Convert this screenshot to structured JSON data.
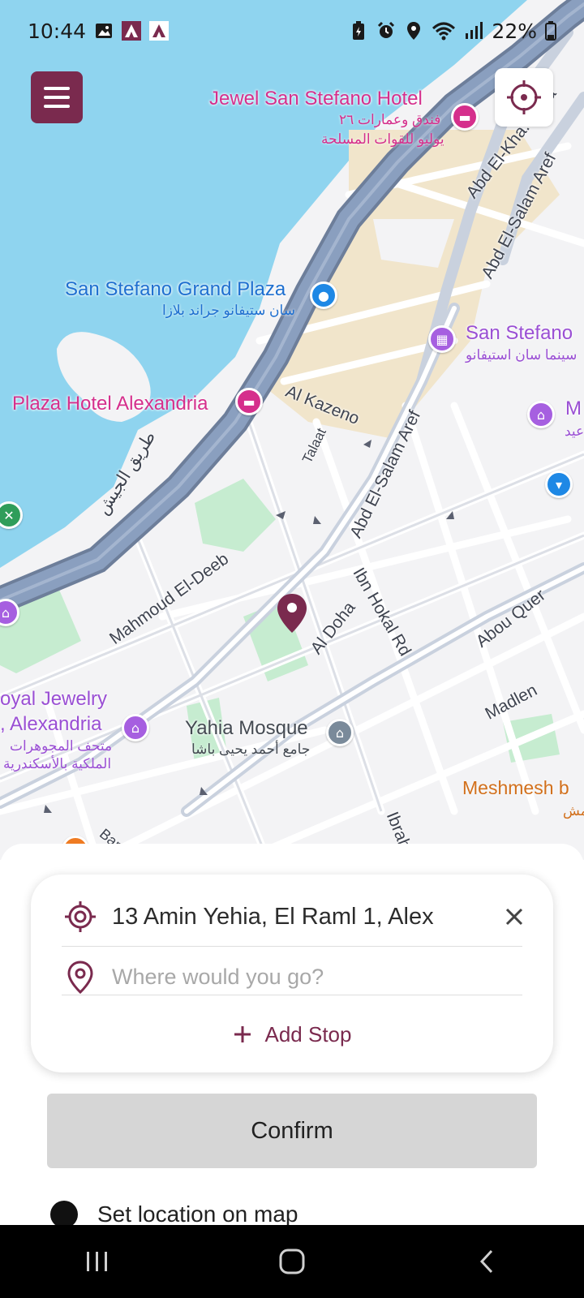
{
  "status_bar": {
    "time": "10:44",
    "battery": "22%"
  },
  "map": {
    "poi": {
      "jewel_hotel": "Jewel San Stefano Hotel",
      "jewel_hotel_ar1": "فندق وعمارات ٢٦",
      "jewel_hotel_ar2": "يوليو للقوات المسلحة",
      "grand_plaza": "San Stefano Grand Plaza",
      "grand_plaza_ar": "سان ستيفانو جراند بلازا",
      "cinema": "San Stefano",
      "cinema_ar": "سينما سان استيفانو",
      "plaza_hotel": "Plaza Hotel Alexandria",
      "museum_partial": "M",
      "museum_partial_ar": "عيد",
      "jewelry_museum_1": "oyal Jewelry",
      "jewelry_museum_2": ", Alexandria",
      "jewelry_museum_ar1": "متحف المجوهرات",
      "jewelry_museum_ar2": "الملكية بالأسكندرية",
      "mosque": "Yahia Mosque",
      "mosque_ar": "جامع أحمد يحيى باشا",
      "restaurant": "Meshmesh b",
      "restaurant_ar": "مش"
    },
    "streets": {
      "army_road_ar": "طريق الجيش",
      "abd_khalek": "Abd El-Kha... Tha",
      "abd_salam_1": "Abd El-Salam Aref",
      "abd_salam_2": "Abd El-Salam Aref",
      "al_kazeno": "Al Kazeno",
      "talaat": "Talaat",
      "mahmoud_deeb": "Mahmoud El-Deeb",
      "al_doha": "Al Doha",
      "ibn_hokal": "Ibn Hokal Rd",
      "abou_quer": "Abou Quer",
      "madlen": "Madlen",
      "ibrahim": "Ibrahi",
      "bar": "Bar"
    }
  },
  "route": {
    "origin": "13 Amin Yehia, El Raml 1, Alex",
    "destination_value": "",
    "destination_placeholder": "Where would you go?",
    "add_stop_label": "Add Stop"
  },
  "confirm_label": "Confirm",
  "set_location_label": "Set location on map",
  "colors": {
    "brand": "#7a2a4e",
    "water": "#8fd4ef",
    "highway": "#8a9fbf",
    "sand": "#f1e5cb",
    "park": "#c6ecd0"
  }
}
